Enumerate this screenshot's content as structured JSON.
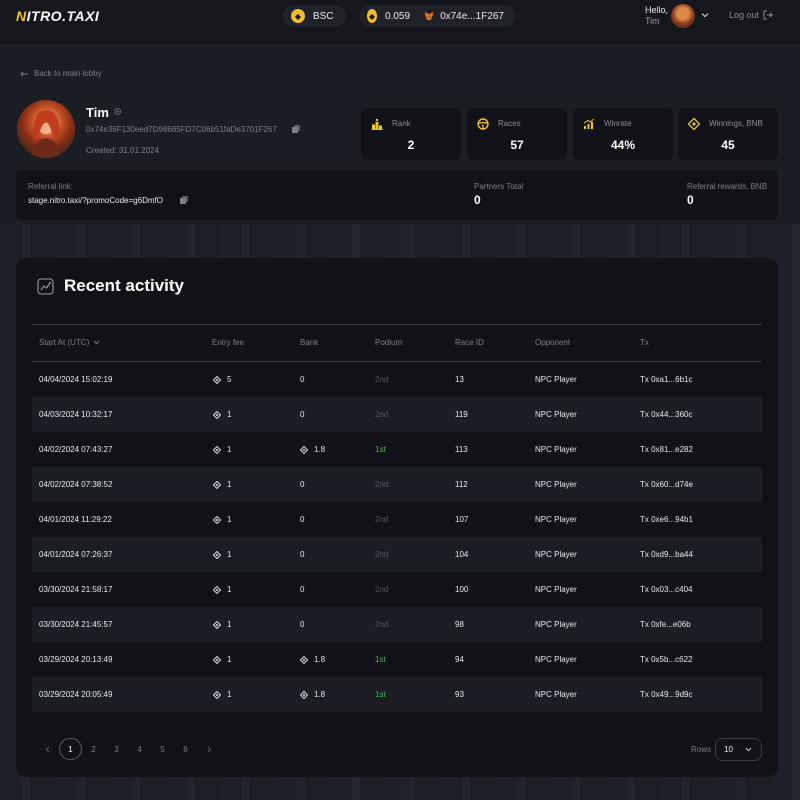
{
  "header": {
    "logo_accent": "N",
    "logo_rest": "ITRO.TAXI",
    "network": "BSC",
    "balance": "0.059",
    "wallet": "0x74e...1F267",
    "greeting": "Hello,",
    "user_name": "Tim",
    "logout_label": "Log out"
  },
  "nav": {
    "back_label": "Back to main lobby"
  },
  "profile": {
    "name": "Tim",
    "address": "0x74e36F130eed7D98665FD7C06b51faDe3701F267",
    "created": "Created: 31.01.2024"
  },
  "stats": [
    {
      "label": "Rank",
      "value": "2",
      "icon": "podium-icon"
    },
    {
      "label": "Races",
      "value": "57",
      "icon": "steering-wheel-icon"
    },
    {
      "label": "Winrate",
      "value": "44%",
      "icon": "chart-bars-icon"
    },
    {
      "label": "Winnings, BNB",
      "value": "45",
      "icon": "bnb-icon"
    }
  ],
  "referral": {
    "link_label": "Referral link:",
    "link_value": "stage.nitro.taxi/?promoCode=g6DmfO",
    "partners_label": "Partners Total",
    "partners_value": "0",
    "rewards_label": "Referral rewards, BNB",
    "rewards_value": "0"
  },
  "activity": {
    "title": "Recent activity",
    "columns": [
      "Start At (UTC)",
      "Entry fee",
      "Bank",
      "Podium",
      "Race ID",
      "Opponent",
      "Tx"
    ],
    "rows": [
      {
        "start": "04/04/2024 15:02:19",
        "fee": "5",
        "bank": "0",
        "podium": "2nd",
        "race_id": "13",
        "opponent": "NPC Player",
        "tx": "Tx 0xa1...6b1c"
      },
      {
        "start": "04/03/2024 10:32:17",
        "fee": "1",
        "bank": "0",
        "podium": "2nd",
        "race_id": "119",
        "opponent": "NPC Player",
        "tx": "Tx 0x44...360c"
      },
      {
        "start": "04/02/2024 07:43:27",
        "fee": "1",
        "bank": "1.8",
        "podium": "1st",
        "race_id": "113",
        "opponent": "NPC Player",
        "tx": "Tx 0x81...e282"
      },
      {
        "start": "04/02/2024 07:38:52",
        "fee": "1",
        "bank": "0",
        "podium": "2nd",
        "race_id": "112",
        "opponent": "NPC Player",
        "tx": "Tx 0x60...d74e"
      },
      {
        "start": "04/01/2024 11:29:22",
        "fee": "1",
        "bank": "0",
        "podium": "2nd",
        "race_id": "107",
        "opponent": "NPC Player",
        "tx": "Tx 0xe6...94b1"
      },
      {
        "start": "04/01/2024 07:26:37",
        "fee": "1",
        "bank": "0",
        "podium": "2nd",
        "race_id": "104",
        "opponent": "NPC Player",
        "tx": "Tx 0xd9...ba44"
      },
      {
        "start": "03/30/2024 21:58:17",
        "fee": "1",
        "bank": "0",
        "podium": "2nd",
        "race_id": "100",
        "opponent": "NPC Player",
        "tx": "Tx 0x03...c404"
      },
      {
        "start": "03/30/2024 21:45:57",
        "fee": "1",
        "bank": "0",
        "podium": "2nd",
        "race_id": "98",
        "opponent": "NPC Player",
        "tx": "Tx 0xfe...e06b"
      },
      {
        "start": "03/29/2024 20:13:49",
        "fee": "1",
        "bank": "1.8",
        "podium": "1st",
        "race_id": "94",
        "opponent": "NPC Player",
        "tx": "Tx 0x5b...c622"
      },
      {
        "start": "03/29/2024 20:05:49",
        "fee": "1",
        "bank": "1.8",
        "podium": "1st",
        "race_id": "93",
        "opponent": "NPC Player",
        "tx": "Tx 0x49...9d9c"
      }
    ]
  },
  "pagination": {
    "pages": [
      "1",
      "2",
      "3",
      "4",
      "5",
      "6"
    ],
    "current": "1",
    "rows_label": "Rows",
    "rows_value": "10"
  },
  "colors": {
    "accent_yellow": "#f3c623",
    "win_green": "#3fbf4a",
    "panel": "#111217",
    "background": "#1b1d25"
  }
}
